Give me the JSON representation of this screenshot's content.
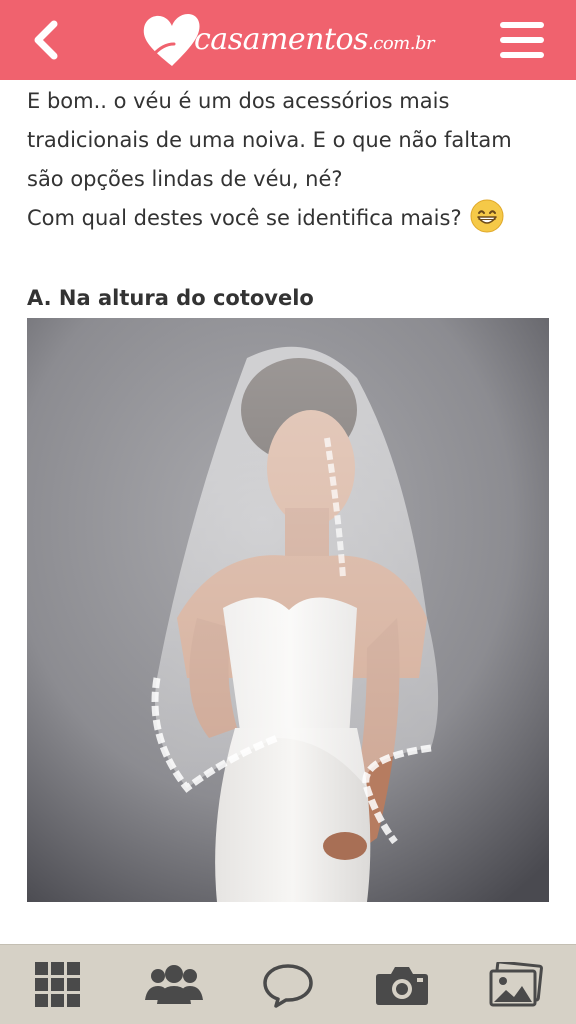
{
  "header": {
    "brand_main": "casamentos",
    "brand_suffix": ".com.br",
    "back_icon": "chevron-left-icon",
    "menu_icon": "hamburger-menu-icon",
    "color": "#f0626e"
  },
  "post": {
    "intro_lines": [
      "E bom.. o véu é um dos acessórios mais",
      "tradicionais de uma noiva. E o que não faltam",
      "são opções lindas de véu, né?",
      "Com qual destes você se identifica mais?"
    ],
    "emoji": "grinning-face-icon",
    "option_title": "A. Na altura do cotovelo",
    "photo": "bride-elbow-length-veil-photo"
  },
  "bottom_nav": {
    "items": [
      {
        "name": "grid-icon"
      },
      {
        "name": "community-icon"
      },
      {
        "name": "chat-icon"
      },
      {
        "name": "camera-icon"
      },
      {
        "name": "photos-icon"
      }
    ],
    "color": "#d6d1c6",
    "icon_color": "#4a4a4a"
  }
}
